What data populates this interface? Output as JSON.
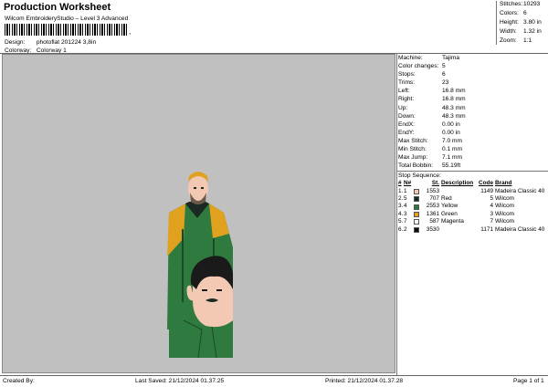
{
  "header": {
    "title": "Production Worksheet",
    "subtitle": "Wilcom EmbroideryStudio – Level 3 Advanced",
    "barcode_tail": ",",
    "design_label": "Design:",
    "design_value": "photoflat 201224 3,8in",
    "colorway_label": "Colorway:",
    "colorway_value": "Colorway 1"
  },
  "summary": {
    "stitches_label": "Stitches:",
    "stitches": "10293",
    "colors_label": "Colors:",
    "colors": "6",
    "height_label": "Height:",
    "height": "3.80 in",
    "width_label": "Width:",
    "width": "1.32 in",
    "zoom_label": "Zoom:",
    "zoom": "1:1"
  },
  "machine": {
    "machine_label": "Machine:",
    "machine": "Tajima",
    "color_changes_label": "Color changes:",
    "color_changes": "5",
    "stops_label": "Stops:",
    "stops": "6",
    "trims_label": "Trims:",
    "trims": "23",
    "left_label": "Left:",
    "left": "16.8 mm",
    "right_label": "Right:",
    "right": "16.8 mm",
    "up_label": "Up:",
    "up": "48.3 mm",
    "down_label": "Down:",
    "down": "48.3 mm",
    "endx_label": "EndX:",
    "endx": "0.00 in",
    "endy_label": "EndY:",
    "endy": "0.00 in",
    "max_stitch_label": "Max Stitch:",
    "max_stitch": "7.0 mm",
    "min_stitch_label": "Min Stitch:",
    "min_stitch": "0.1 mm",
    "max_jump_label": "Max Jump:",
    "max_jump": "7.1 mm",
    "total_bobbin_label": "Total Bobbin:",
    "total_bobbin": "55.19ft"
  },
  "stop_sequence": {
    "title": "Stop Sequence:",
    "headers": {
      "num": "#",
      "n": "N#",
      "st": "St.",
      "desc": "Description",
      "code": "Code",
      "brand": "Brand"
    },
    "rows": [
      {
        "num": "1.",
        "n": "1",
        "color": "#f3c9b3",
        "st": "1553",
        "desc": "",
        "code": "1149",
        "brand": "Madeira Classic 40"
      },
      {
        "num": "2.",
        "n": "5",
        "color": "#1a2a22",
        "st": "707",
        "desc": "Red",
        "code": "5",
        "brand": "Wilcom"
      },
      {
        "num": "3.",
        "n": "4",
        "color": "#2f7a3e",
        "st": "2553",
        "desc": "Yellow",
        "code": "4",
        "brand": "Wilcom"
      },
      {
        "num": "4.",
        "n": "3",
        "color": "#e0a21e",
        "st": "1361",
        "desc": "Green",
        "code": "3",
        "brand": "Wilcom"
      },
      {
        "num": "5.",
        "n": "7",
        "color": "#ffffff",
        "st": "587",
        "desc": "Magenta",
        "code": "7",
        "brand": "Wilcom"
      },
      {
        "num": "6.",
        "n": "2",
        "color": "#0d0d0d",
        "st": "3530",
        "desc": "",
        "code": "1171",
        "brand": "Madeira Classic 40"
      }
    ]
  },
  "footer": {
    "created_by": "Created By:",
    "last_saved": "Last Saved: 21/12/2024 01.37.25",
    "printed": "Printed: 21/12/2024 01.37.28",
    "page": "Page 1 of 1"
  },
  "colors": {
    "canvas_bg": "#c0c0c0",
    "green": "#2f7a3e",
    "yellow": "#e0a21e",
    "skin": "#f3c9b3",
    "dark": "#1a2a22"
  }
}
